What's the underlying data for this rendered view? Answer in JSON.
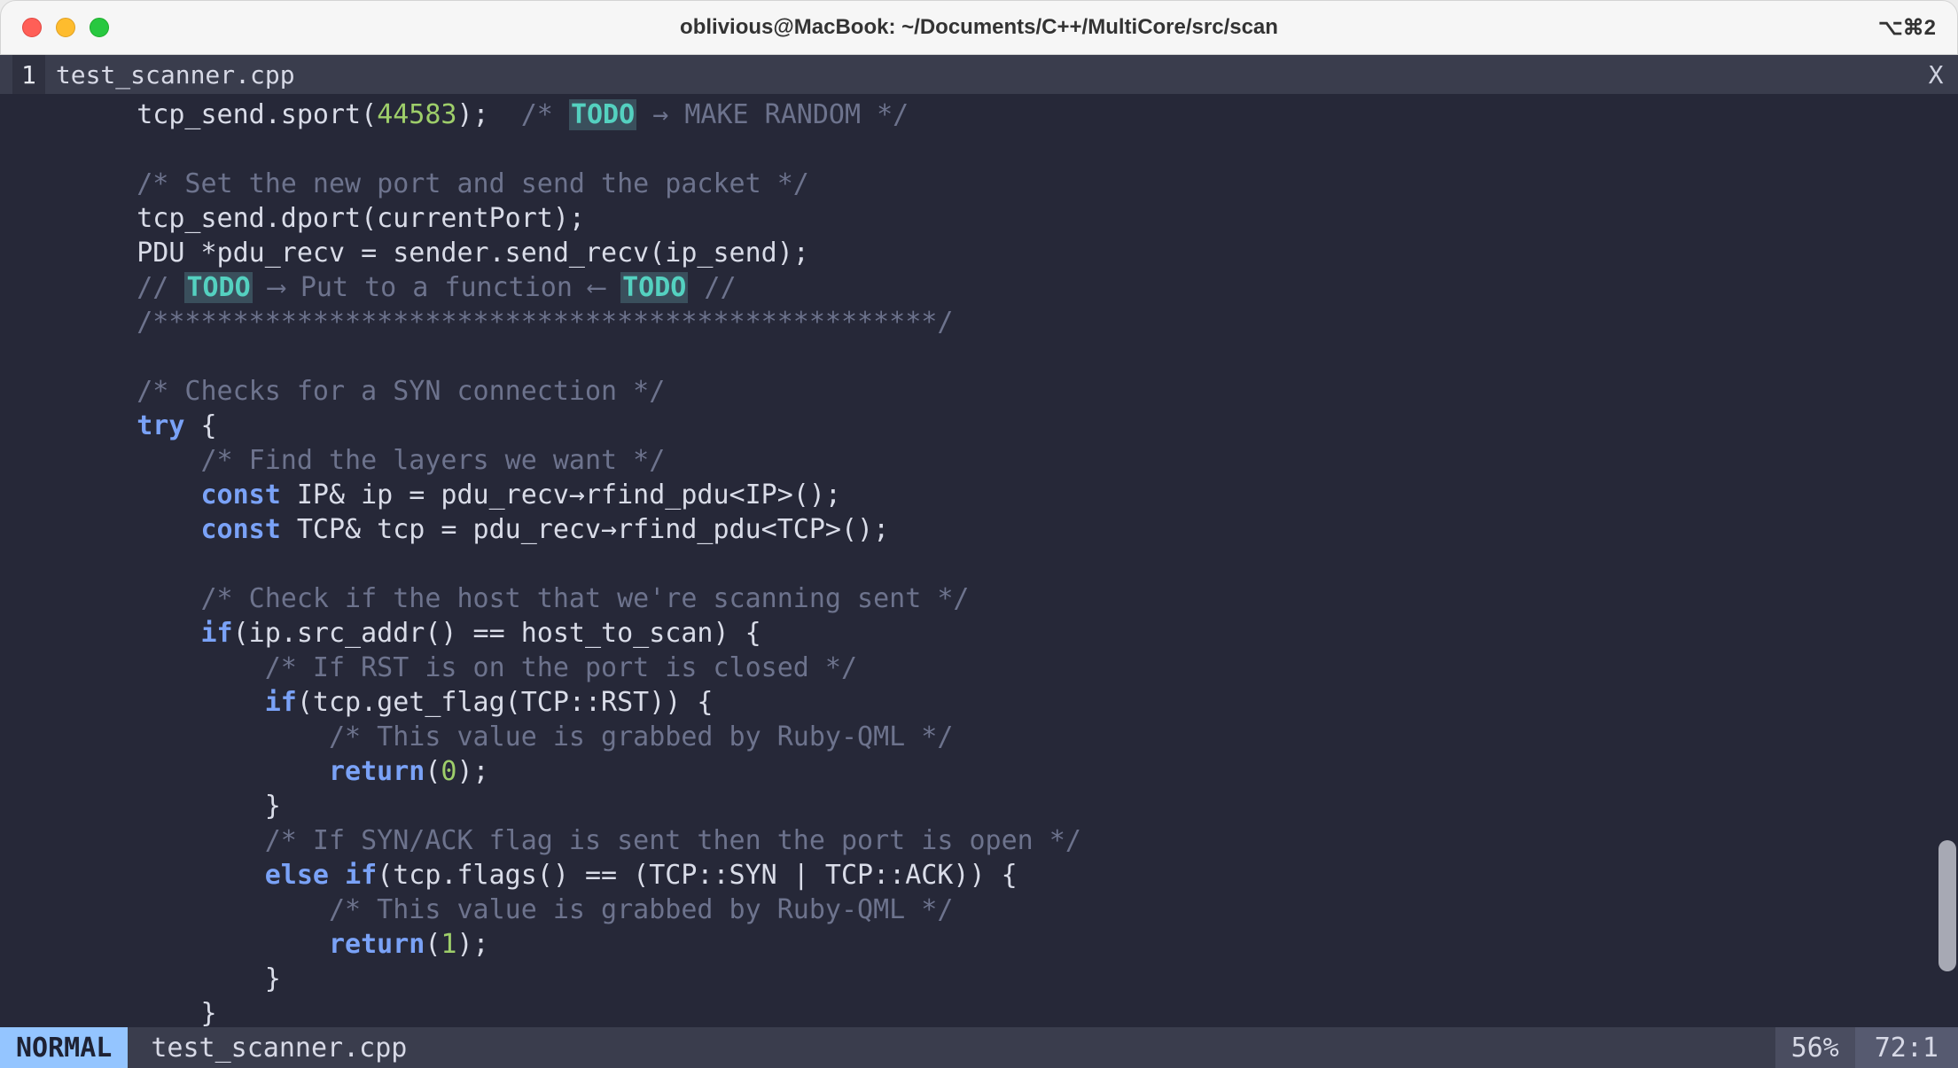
{
  "window": {
    "title": "oblivious@MacBook: ~/Documents/C++/MultiCore/src/scan",
    "shortcut": "⌥⌘2"
  },
  "tabline": {
    "buffers": [
      {
        "index": "1",
        "name": "test_scanner.cpp"
      }
    ],
    "close_label": "X"
  },
  "code": {
    "lines": [
      {
        "indent": 4,
        "segs": [
          {
            "t": "tcp_send.sport(",
            "c": "fn"
          },
          {
            "t": "44583",
            "c": "num"
          },
          {
            "t": ");  ",
            "c": "punc"
          },
          {
            "t": "/* ",
            "c": "cmt"
          },
          {
            "t": "TODO",
            "c": "hl-todo"
          },
          {
            "t": " → MAKE RANDOM */",
            "c": "cmt"
          }
        ]
      },
      {
        "blank": true
      },
      {
        "indent": 4,
        "segs": [
          {
            "t": "/* Set the new port and send the packet */",
            "c": "cmt"
          }
        ]
      },
      {
        "indent": 4,
        "segs": [
          {
            "t": "tcp_send.dport(currentPort);",
            "c": "fn"
          }
        ]
      },
      {
        "indent": 4,
        "segs": [
          {
            "t": "PDU *pdu_recv = sender.send_recv(ip_send);",
            "c": "fn"
          }
        ]
      },
      {
        "indent": 4,
        "segs": [
          {
            "t": "// ",
            "c": "cmt"
          },
          {
            "t": "TODO",
            "c": "hl-todo"
          },
          {
            "t": " ⟶ Put to a function ⟵ ",
            "c": "cmt"
          },
          {
            "t": "TODO",
            "c": "hl-todo"
          },
          {
            "t": " //",
            "c": "cmt"
          }
        ]
      },
      {
        "indent": 4,
        "segs": [
          {
            "t": "/*************************************************/",
            "c": "cmt"
          }
        ]
      },
      {
        "blank": true
      },
      {
        "indent": 4,
        "segs": [
          {
            "t": "/* Checks for a SYN connection */",
            "c": "cmt"
          }
        ]
      },
      {
        "indent": 4,
        "segs": [
          {
            "t": "try",
            "c": "kw"
          },
          {
            "t": " {",
            "c": "punc"
          }
        ]
      },
      {
        "indent": 8,
        "segs": [
          {
            "t": "/* Find the layers we want */",
            "c": "cmt"
          }
        ]
      },
      {
        "indent": 8,
        "segs": [
          {
            "t": "const",
            "c": "kw"
          },
          {
            "t": " IP& ip = pdu_recv→rfind_pdu<IP>();",
            "c": "fn"
          }
        ]
      },
      {
        "indent": 8,
        "segs": [
          {
            "t": "const",
            "c": "kw"
          },
          {
            "t": " TCP& tcp = pdu_recv→rfind_pdu<TCP>();",
            "c": "fn"
          }
        ]
      },
      {
        "blank": true
      },
      {
        "indent": 8,
        "segs": [
          {
            "t": "/* Check if the host that we're scanning sent */",
            "c": "cmt"
          }
        ]
      },
      {
        "indent": 8,
        "segs": [
          {
            "t": "if",
            "c": "kw"
          },
          {
            "t": "(ip.src_addr() == host_to_scan) {",
            "c": "fn"
          }
        ]
      },
      {
        "indent": 12,
        "segs": [
          {
            "t": "/* If RST is on the port is closed */",
            "c": "cmt"
          }
        ]
      },
      {
        "indent": 12,
        "segs": [
          {
            "t": "if",
            "c": "kw"
          },
          {
            "t": "(tcp.get_flag(TCP::RST)) {",
            "c": "fn"
          }
        ]
      },
      {
        "indent": 16,
        "segs": [
          {
            "t": "/* This value is grabbed by Ruby-QML */",
            "c": "cmt"
          }
        ]
      },
      {
        "indent": 16,
        "segs": [
          {
            "t": "return",
            "c": "kw"
          },
          {
            "t": "(",
            "c": "punc"
          },
          {
            "t": "0",
            "c": "num"
          },
          {
            "t": ");",
            "c": "punc"
          }
        ]
      },
      {
        "indent": 12,
        "segs": [
          {
            "t": "}",
            "c": "punc"
          }
        ]
      },
      {
        "indent": 12,
        "segs": [
          {
            "t": "/* If SYN/ACK flag is sent then the port is open */",
            "c": "cmt"
          }
        ]
      },
      {
        "indent": 12,
        "segs": [
          {
            "t": "else",
            "c": "kw"
          },
          {
            "t": " ",
            "c": "fn"
          },
          {
            "t": "if",
            "c": "kw"
          },
          {
            "t": "(tcp.flags() == (TCP::SYN | TCP::ACK)) {",
            "c": "fn"
          }
        ]
      },
      {
        "indent": 16,
        "segs": [
          {
            "t": "/* This value is grabbed by Ruby-QML */",
            "c": "cmt"
          }
        ]
      },
      {
        "indent": 16,
        "segs": [
          {
            "t": "return",
            "c": "kw"
          },
          {
            "t": "(",
            "c": "punc"
          },
          {
            "t": "1",
            "c": "num"
          },
          {
            "t": ");",
            "c": "punc"
          }
        ]
      },
      {
        "indent": 12,
        "segs": [
          {
            "t": "}",
            "c": "punc"
          }
        ]
      },
      {
        "indent": 8,
        "segs": [
          {
            "t": "}",
            "c": "punc"
          }
        ]
      }
    ]
  },
  "status": {
    "mode": "NORMAL",
    "file": "test_scanner.cpp",
    "percent": "56%",
    "position": "72:1"
  },
  "scrollbar": {
    "thumb_top_pct": 80,
    "thumb_height_pct": 14
  }
}
